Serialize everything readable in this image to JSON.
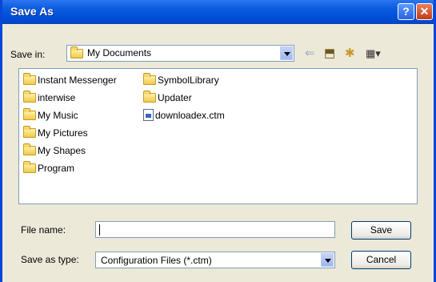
{
  "window": {
    "title": "Save As"
  },
  "titlebar": {
    "help_glyph": "?",
    "close_glyph": "✕"
  },
  "save_in": {
    "label": "Save in:",
    "value": "My Documents",
    "icon": "my-documents-icon"
  },
  "toolbar": {
    "back_glyph": "⇐",
    "up_glyph": "⬒",
    "new_folder_glyph": "✱",
    "view_glyph": "▦▾"
  },
  "files": [
    {
      "name": "Instant Messenger",
      "type": "folder"
    },
    {
      "name": "interwise",
      "type": "folder"
    },
    {
      "name": "My Music",
      "type": "special-folder"
    },
    {
      "name": "My Pictures",
      "type": "special-folder"
    },
    {
      "name": "My Shapes",
      "type": "special-folder"
    },
    {
      "name": "Program",
      "type": "folder"
    },
    {
      "name": "SymbolLibrary",
      "type": "folder"
    },
    {
      "name": "Updater",
      "type": "folder"
    },
    {
      "name": "downloadex.ctm",
      "type": "file"
    }
  ],
  "file_name": {
    "label": "File name:",
    "value": ""
  },
  "save_as_type": {
    "label": "Save as type:",
    "value": "Configuration Files (*.ctm)"
  },
  "buttons": {
    "save": "Save",
    "cancel": "Cancel"
  },
  "colors": {
    "title_bar": "#0050d8",
    "dialog_bg": "#ece9d8",
    "close": "#c2391a"
  }
}
